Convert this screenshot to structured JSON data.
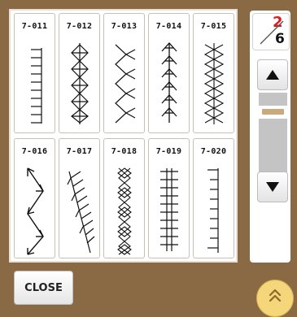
{
  "stitches": [
    {
      "code": "7-011",
      "icon": "stitch-ladder-icon"
    },
    {
      "code": "7-012",
      "icon": "stitch-diamond-chain-icon"
    },
    {
      "code": "7-013",
      "icon": "stitch-feather-zigzag-icon"
    },
    {
      "code": "7-014",
      "icon": "stitch-chevron-stack-icon"
    },
    {
      "code": "7-015",
      "icon": "stitch-double-cross-icon"
    },
    {
      "code": "7-016",
      "icon": "stitch-arrow-zigzag-icon"
    },
    {
      "code": "7-017",
      "icon": "stitch-herringbone-icon"
    },
    {
      "code": "7-018",
      "icon": "stitch-braid-icon"
    },
    {
      "code": "7-019",
      "icon": "stitch-cross-bar-icon"
    },
    {
      "code": "7-020",
      "icon": "stitch-comb-icon"
    }
  ],
  "page": {
    "current": "2",
    "total": "6"
  },
  "scroll": {
    "up_icon": "arrow-up-icon",
    "down_icon": "arrow-down-icon",
    "position": 0.2
  },
  "close_label": "CLOSE",
  "expand_icon": "double-chevron-up-icon",
  "colors": {
    "background": "#8a6a45",
    "page_current": "#d81e1e",
    "expand_button": "#f6d67a",
    "thumb_grip": "#c8aa7c"
  }
}
